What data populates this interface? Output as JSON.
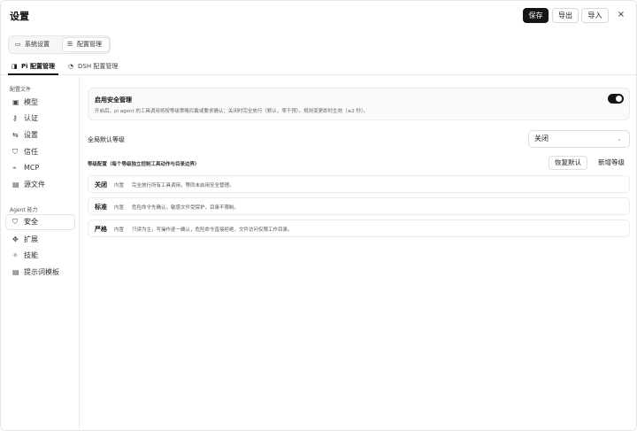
{
  "header": {
    "title": "设置",
    "save_label": "保存",
    "export_label": "导出",
    "import_label": "导入",
    "close_glyph": "×"
  },
  "top_tabs": [
    {
      "label": "系统设置",
      "icon": "monitor-icon",
      "glyph": "▭"
    },
    {
      "label": "配置管理",
      "icon": "sliders-icon",
      "glyph": "☰",
      "active": true
    }
  ],
  "sub_tabs": [
    {
      "label": "Pi 配置管理",
      "icon": "pi-icon",
      "glyph": "◨",
      "active": true
    },
    {
      "label": "DSH 配置管理",
      "icon": "dsh-icon",
      "glyph": "◔"
    }
  ],
  "sidebar": {
    "section1": "配置文件",
    "items1": [
      {
        "label": "模型",
        "icon": "model-icon",
        "glyph": "▣"
      },
      {
        "label": "认证",
        "icon": "key-icon",
        "glyph": "⚷"
      },
      {
        "label": "设置",
        "icon": "toggles-icon",
        "glyph": "⇆"
      },
      {
        "label": "信任",
        "icon": "shield-check-icon",
        "glyph": "⛉"
      },
      {
        "label": "MCP",
        "icon": "plug-icon",
        "glyph": "⌁"
      },
      {
        "label": "源文件",
        "icon": "file-icon",
        "glyph": "▤"
      }
    ],
    "section2": "Agent 能力",
    "items2": [
      {
        "label": "安全",
        "icon": "shield-icon",
        "glyph": "⛉",
        "active": true
      },
      {
        "label": "扩展",
        "icon": "puzzle-icon",
        "glyph": "✥"
      },
      {
        "label": "技能",
        "icon": "sparkle-icon",
        "glyph": "✧"
      },
      {
        "label": "提示词模板",
        "icon": "document-icon",
        "glyph": "▤"
      }
    ]
  },
  "safety": {
    "title": "启用安全管理",
    "description": "开启后，pi agent 的工具调用将按等级策略拦截或要求确认；关闭时完全放行（默认，零干预）。规则变更即时生效（≤2 秒）。",
    "enabled": true
  },
  "default_level": {
    "label": "全局默认等级",
    "value": "关闭"
  },
  "levels_section": {
    "label": "等级配置（每个等级独立控制工具动作与目录边界）",
    "restore_label": "恢复默认",
    "new_label": "新增等级"
  },
  "levels": [
    {
      "name": "关闭",
      "badge": "内置",
      "description": "完全放行所有工具调用，等同未启用安全管理。"
    },
    {
      "name": "标准",
      "badge": "内置",
      "description": "危险命令先确认，敏感文件受保护，目录不限制。"
    },
    {
      "name": "严格",
      "badge": "内置",
      "description": "只读为主，写操作逐一确认，危险命令直接拒绝，文件访问仅限工作目录。"
    }
  ],
  "colors": {
    "primary": "#151515",
    "border": "#e6e6e6",
    "muted_text": "#666666"
  }
}
